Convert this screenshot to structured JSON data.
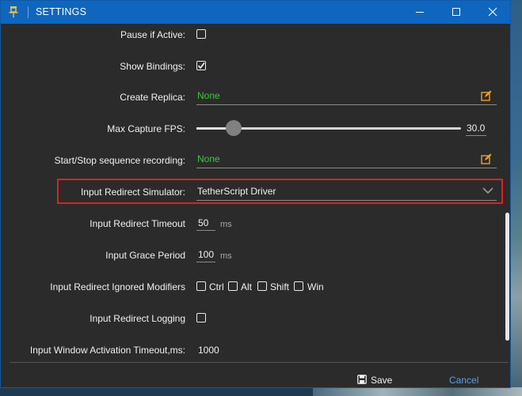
{
  "window": {
    "title": "SETTINGS",
    "pin_icon": "pin-icon",
    "controls": [
      "minimize-icon",
      "maximize-icon",
      "close-icon"
    ]
  },
  "settings": {
    "pause_if_active": {
      "label": "Pause if Active:",
      "checked": false
    },
    "show_bindings": {
      "label": "Show Bindings:",
      "checked": true
    },
    "create_replica": {
      "label": "Create Replica:",
      "value": "None",
      "icon": "edit-icon"
    },
    "max_capture_fps": {
      "label": "Max Capture FPS:",
      "value": "30.0",
      "slider_fraction": 0.14
    },
    "sequence_recording": {
      "label": "Start/Stop sequence recording:",
      "value": "None",
      "icon": "edit-icon"
    },
    "input_redirect_simulator": {
      "label": "Input Redirect Simulator:",
      "value": "TetherScript Driver"
    },
    "input_redirect_timeout": {
      "label": "Input Redirect Timeout",
      "value": "50",
      "unit": "ms"
    },
    "input_grace_period": {
      "label": "Input Grace Period",
      "value": "100",
      "unit": "ms"
    },
    "ignored_modifiers": {
      "label": "Input Redirect Ignored Modifiers",
      "options": [
        {
          "label": "Ctrl",
          "checked": false
        },
        {
          "label": "Alt",
          "checked": false
        },
        {
          "label": "Shift",
          "checked": false
        },
        {
          "label": "Win",
          "checked": false
        }
      ]
    },
    "input_redirect_logging": {
      "label": "Input Redirect Logging",
      "checked": false
    },
    "activation_timeout": {
      "label": "Input Window Activation Timeout,ms:",
      "value": "1000"
    }
  },
  "footer": {
    "save_label": "Save",
    "cancel_label": "Cancel"
  },
  "colors": {
    "accent": "#0f66bf",
    "value_green": "#3cc83c",
    "highlight_red": "#e02020",
    "link_blue": "#5aa0e8"
  }
}
